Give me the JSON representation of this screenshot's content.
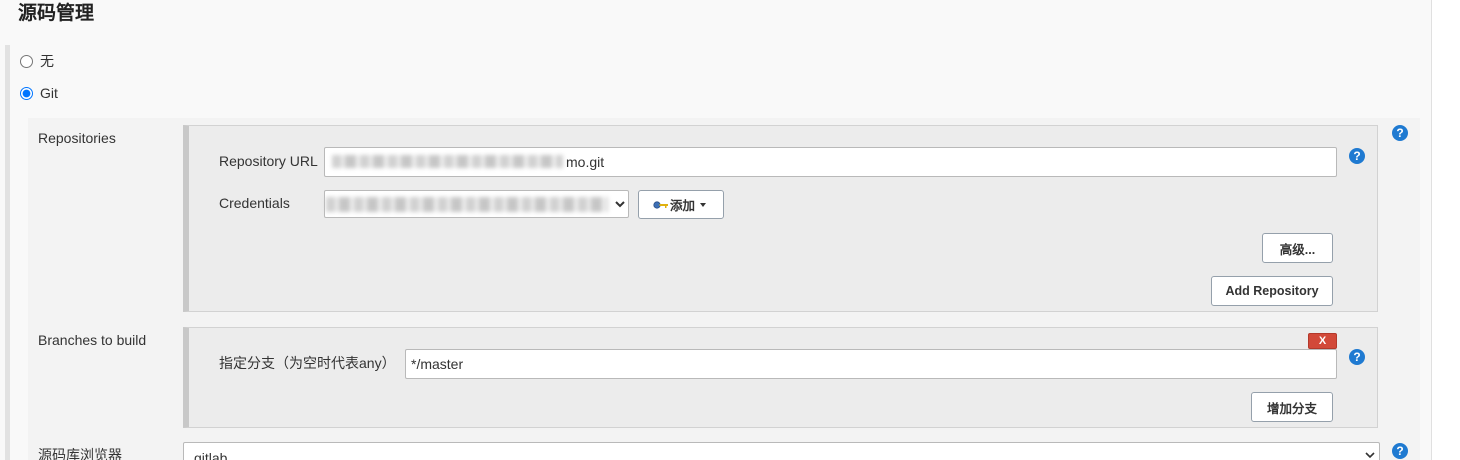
{
  "section_title": "源码管理",
  "scm_options": [
    {
      "label": "无",
      "checked": false
    },
    {
      "label": "Git",
      "checked": true
    }
  ],
  "repositories": {
    "label": "Repositories",
    "url_label": "Repository URL",
    "url_value": "mo.git",
    "credentials_label": "Credentials",
    "add_credentials_label": "添加",
    "advanced_label": "高级...",
    "add_repository_label": "Add Repository"
  },
  "branches": {
    "label": "Branches to build",
    "delete_label": "X",
    "branch_specifier_label": "指定分支（为空时代表any）",
    "branch_specifier_value": "*/master",
    "add_branch_label": "增加分支"
  },
  "repository_browser": {
    "label": "源码库浏览器",
    "selected": "gitlab"
  },
  "help_glyph": "?",
  "icons": {
    "help": "question-circle-icon",
    "credentials": "key-icon",
    "dropdown": "caret-down-icon",
    "select": "chevron-down-icon"
  },
  "colors": {
    "help_icon": "#1f7ad1",
    "delete_button": "#d24939",
    "chunk_background": "#ececec",
    "page_background": "#f9f9f9"
  }
}
